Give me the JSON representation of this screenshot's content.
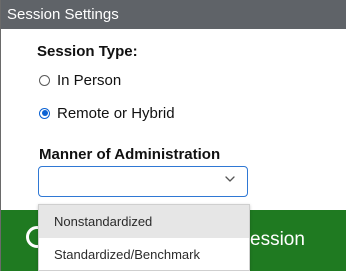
{
  "header": {
    "title": "Session Settings"
  },
  "session_type": {
    "label": "Session Type:",
    "options": [
      {
        "label": "In Person",
        "selected": false
      },
      {
        "label": "Remote or Hybrid",
        "selected": true
      }
    ]
  },
  "manner": {
    "label": "Manner of Administration",
    "selected_value": "",
    "options": [
      {
        "label": "Nonstandardized",
        "highlighted": true
      },
      {
        "label": "Standardized/Benchmark",
        "highlighted": false
      }
    ]
  },
  "footer_button": {
    "visible_text": "ession"
  },
  "colors": {
    "header_bg": "#5f6368",
    "accent_blue": "#0b62d4",
    "select_border": "#2f78d4",
    "green_bar": "#1f7a21",
    "option_hover": "#e6e6e6"
  },
  "icons": {
    "radio": "radio-button",
    "chevron": "chevron-down-icon"
  }
}
